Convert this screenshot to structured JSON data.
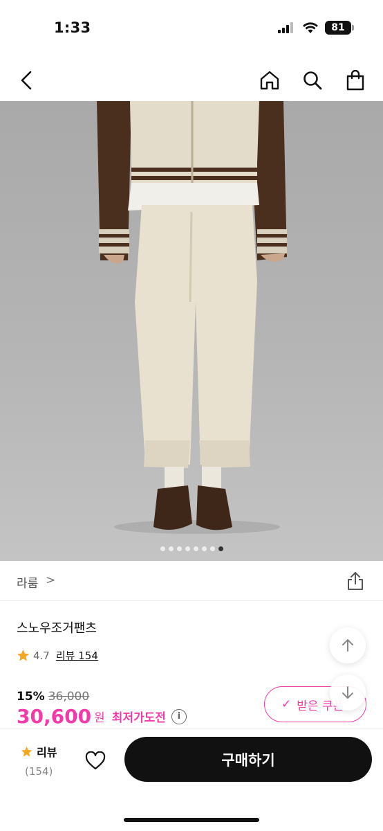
{
  "status": {
    "time": "1:33",
    "battery": "81"
  },
  "nav": {
    "back_icon": "chevron-left-icon",
    "home_icon": "home-icon",
    "search_icon": "search-icon",
    "cart_icon": "shopping-bag-icon"
  },
  "gallery": {
    "image_description_icon": "product-photo",
    "slide_count": 8,
    "active_index": 7
  },
  "brand": {
    "name": "라룸",
    "chevron": ">"
  },
  "product": {
    "title": "스노우조거팬츠",
    "rating": "4.7",
    "review_link": "리뷰 154",
    "discount": "15%",
    "original_price": "36,000",
    "price": "30,600",
    "currency": "원",
    "lowest_price_label": "최저가도전",
    "info_glyph": "i"
  },
  "coupon": {
    "label": "받은 쿠폰",
    "check": "✓"
  },
  "bottom": {
    "review_label": "리뷰",
    "review_count": "(154)",
    "buy_label": "구매하기"
  },
  "colors": {
    "accent": "#f23aa8",
    "star": "#f5a623",
    "buy_button": "#111111"
  }
}
